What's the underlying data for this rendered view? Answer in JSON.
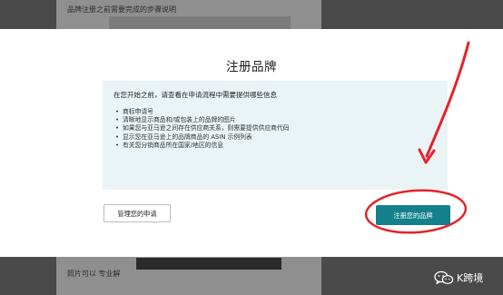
{
  "background": {
    "top_text": "品牌注册之前需要完成的步骤说明",
    "bottom_text": "照片可以 专业解"
  },
  "modal": {
    "title": "注册品牌",
    "info_heading": "在您开始之前，请查看在申请流程中需要提供哪些信息",
    "info_items": [
      "商标申请号",
      "清晰地显示商品和/或包装上的品牌的图片",
      "如果您与亚马逊之间存在供应商关系，则需要提供供应商代码",
      "显示您在亚马逊上的品牌商品的 ASIN 示例列表",
      "有关您分销商品所在国家/地区的信息"
    ],
    "manage_button": "管理您的申请",
    "register_button": "注册您的品牌"
  },
  "annotation": {
    "color": "#e3242b",
    "icon": "red-arrow-and-circle"
  },
  "watermark": {
    "text": "K跨境",
    "icon": "wechat-icon"
  },
  "colors": {
    "primary_button": "#14808c",
    "info_box": "#eaf4f6",
    "overlay": "#4a4a4a"
  }
}
